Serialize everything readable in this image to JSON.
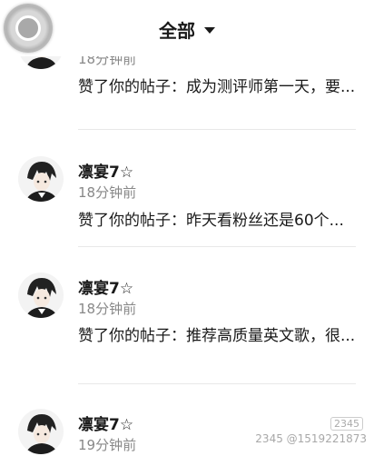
{
  "header": {
    "filter_label": "全部"
  },
  "notifications": [
    {
      "name": "",
      "time": "18分钟前",
      "content": "赞了你的帖子：成为测评师第一天，要..."
    },
    {
      "name": "凛宴7☆",
      "time": "18分钟前",
      "content": "赞了你的帖子：昨天看粉丝还是60个..."
    },
    {
      "name": "凛宴7☆",
      "time": "18分钟前",
      "content": "赞了你的帖子：推荐高质量英文歌，很..."
    },
    {
      "name": "凛宴7☆",
      "time": "19分钟前",
      "content": ""
    }
  ],
  "watermark": {
    "badge": "2345",
    "id": "2345 @1519221873"
  },
  "colors": {
    "text": "#1a1a1a",
    "secondary": "#888888",
    "divider": "#e8e8e8"
  },
  "icons": {
    "filter_dropdown": "triangle-down-icon",
    "floating_button": "assistive-touch-icon"
  }
}
